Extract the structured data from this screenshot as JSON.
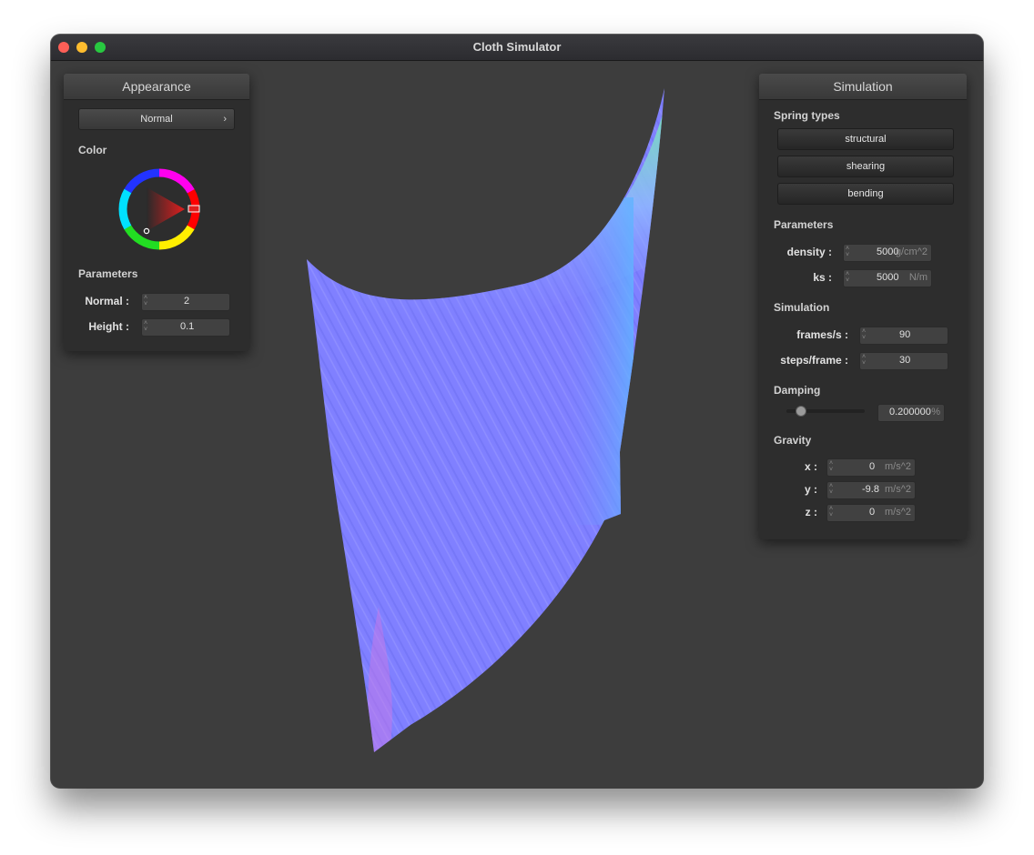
{
  "window": {
    "title": "Cloth Simulator"
  },
  "appearance": {
    "header": "Appearance",
    "shader_value": "Normal",
    "color_label": "Color",
    "parameters_label": "Parameters",
    "normal_label": "Normal :",
    "normal_value": "2",
    "height_label": "Height :",
    "height_value": "0.1"
  },
  "simulation": {
    "header": "Simulation",
    "spring_types_label": "Spring types",
    "spring_buttons": [
      "structural",
      "shearing",
      "bending"
    ],
    "parameters_label": "Parameters",
    "density_label": "density :",
    "density_value": "5000",
    "density_unit": "g/cm^2",
    "ks_label": "ks :",
    "ks_value": "5000",
    "ks_unit": "N/m",
    "simulation_label": "Simulation",
    "fps_label": "frames/s :",
    "fps_value": "90",
    "steps_label": "steps/frame :",
    "steps_value": "30",
    "damping_label": "Damping",
    "damping_value": "0.200000",
    "damping_unit": "%",
    "gravity_label": "Gravity",
    "gx_label": "x :",
    "gx_value": "0",
    "gy_label": "y :",
    "gy_value": "-9.8",
    "gz_label": "z :",
    "gz_value": "0",
    "gravity_unit": "m/s^2"
  },
  "colors": {
    "window_bg": "#3c3c3c",
    "panel_bg": "#2d2d2d",
    "cloth_base": "#8080ff",
    "cloth_highlight": "#70f0a0",
    "selected_color": "#e01e1e"
  }
}
